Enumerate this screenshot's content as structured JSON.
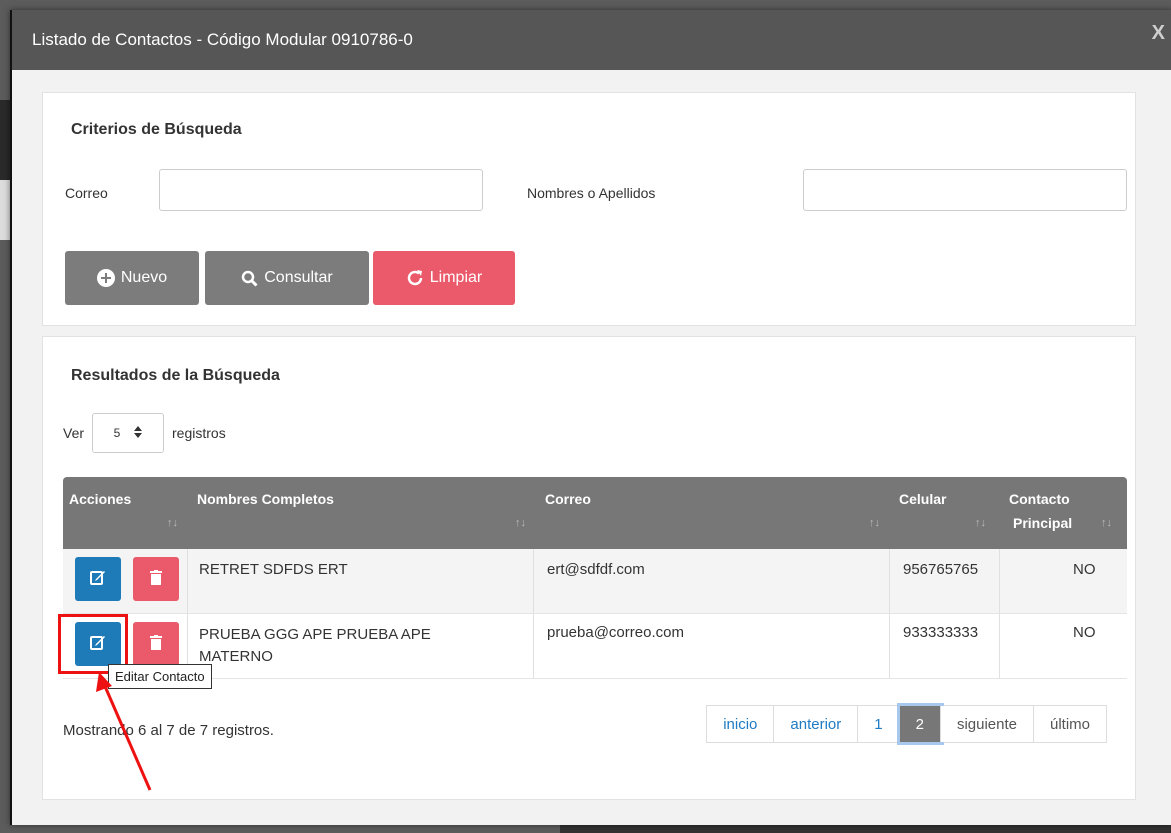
{
  "modal": {
    "title": "Listado de Contactos - Código Modular 0910786-0",
    "close_label": "X"
  },
  "criteria": {
    "heading": "Criterios de Búsqueda",
    "correo_label": "Correo",
    "correo_value": "",
    "nombres_label": "Nombres o Apellidos",
    "nombres_value": "",
    "btn_nuevo": "Nuevo",
    "btn_consultar": "Consultar",
    "btn_limpiar": "Limpiar"
  },
  "results": {
    "heading": "Resultados de la Búsqueda",
    "ver_label": "Ver",
    "page_size": "5",
    "registros_label": "registros",
    "columns": [
      "Acciones",
      "Nombres Completos",
      "Correo",
      "Celular",
      "Contacto",
      "Principal"
    ],
    "rows": [
      {
        "nombres": "RETRET SDFDS ERT",
        "correo": "ert@sdfdf.com",
        "celular": "956765765",
        "principal": "NO"
      },
      {
        "nombres_line1": "PRUEBA GGG APE PRUEBA APE",
        "nombres_line2": "MATERNO",
        "correo": "prueba@correo.com",
        "celular": "933333333",
        "principal": "NO"
      }
    ],
    "tooltip": "Editar Contacto",
    "status": "Mostrando 6 al 7 de 7 registros.",
    "pager": [
      "inicio",
      "anterior",
      "1",
      "2",
      "siguiente",
      "último"
    ]
  },
  "colors": {
    "header": "#565656",
    "primary": "#1f7ab8",
    "danger": "#ea5a6a",
    "gray": "#7c7c7c"
  }
}
